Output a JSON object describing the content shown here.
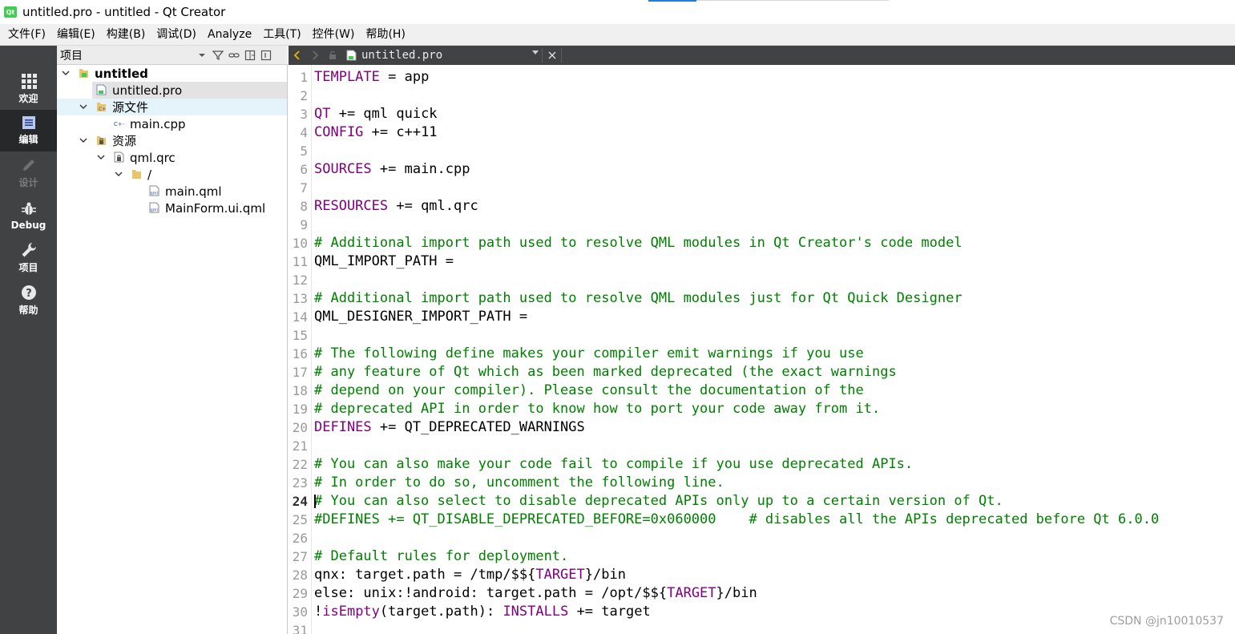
{
  "window": {
    "title": "untitled.pro - untitled - Qt Creator",
    "logo_text": "Qt"
  },
  "menubar": {
    "items": [
      "文件(F)",
      "编辑(E)",
      "构建(B)",
      "调试(D)",
      "Analyze",
      "工具(T)",
      "控件(W)",
      "帮助(H)"
    ]
  },
  "modes": [
    {
      "label": "欢迎",
      "icon": "grid-icon",
      "state": "normal"
    },
    {
      "label": "编辑",
      "icon": "document-icon",
      "state": "active"
    },
    {
      "label": "设计",
      "icon": "pencil-icon",
      "state": "disabled"
    },
    {
      "label": "Debug",
      "icon": "bug-icon",
      "state": "normal"
    },
    {
      "label": "项目",
      "icon": "wrench-icon",
      "state": "normal"
    },
    {
      "label": "帮助",
      "icon": "help-icon",
      "state": "normal"
    }
  ],
  "project_pane": {
    "title": "项目",
    "tools": [
      "filter-icon",
      "link-icon",
      "split-icon",
      "close-pane-icon"
    ],
    "tree": [
      {
        "label": "untitled",
        "bold": true,
        "expanded": true,
        "icon": "project-icon"
      },
      {
        "label": "untitled.pro",
        "selected": true,
        "icon": "pro-file-icon"
      },
      {
        "label": "源文件",
        "expanded": true,
        "icon": "source-folder-icon"
      },
      {
        "label": "main.cpp",
        "icon": "cpp-file-icon"
      },
      {
        "label": "资源",
        "expanded": true,
        "icon": "resource-folder-icon"
      },
      {
        "label": "qml.qrc",
        "expanded": true,
        "icon": "qrc-file-icon"
      },
      {
        "label": "/",
        "expanded": true,
        "icon": "folder-icon"
      },
      {
        "label": "main.qml",
        "icon": "qml-file-icon"
      },
      {
        "label": "MainForm.ui.qml",
        "icon": "qml-file-icon"
      }
    ]
  },
  "editor": {
    "open_file": "untitled.pro",
    "current_line": 24,
    "lines": [
      {
        "n": "1",
        "segs": [
          {
            "t": "TEMPLATE",
            "c": "kw"
          },
          {
            "t": " = app",
            "c": ""
          }
        ]
      },
      {
        "n": "2",
        "segs": []
      },
      {
        "n": "3",
        "segs": [
          {
            "t": "QT",
            "c": "kw"
          },
          {
            "t": " += qml quick",
            "c": ""
          }
        ]
      },
      {
        "n": "4",
        "segs": [
          {
            "t": "CONFIG",
            "c": "kw"
          },
          {
            "t": " += c++11",
            "c": ""
          }
        ]
      },
      {
        "n": "5",
        "segs": []
      },
      {
        "n": "6",
        "segs": [
          {
            "t": "SOURCES",
            "c": "kw"
          },
          {
            "t": " += main.cpp",
            "c": ""
          }
        ]
      },
      {
        "n": "7",
        "segs": []
      },
      {
        "n": "8",
        "segs": [
          {
            "t": "RESOURCES",
            "c": "kw"
          },
          {
            "t": " += qml.qrc",
            "c": ""
          }
        ]
      },
      {
        "n": "9",
        "segs": []
      },
      {
        "n": "10",
        "segs": [
          {
            "t": "# Additional import path used to resolve QML modules in Qt Creator's code model",
            "c": "cm"
          }
        ]
      },
      {
        "n": "11",
        "segs": [
          {
            "t": "QML_IMPORT_PATH =",
            "c": ""
          }
        ]
      },
      {
        "n": "12",
        "segs": []
      },
      {
        "n": "13",
        "segs": [
          {
            "t": "# Additional import path used to resolve QML modules just for Qt Quick Designer",
            "c": "cm"
          }
        ]
      },
      {
        "n": "14",
        "segs": [
          {
            "t": "QML_DESIGNER_IMPORT_PATH =",
            "c": ""
          }
        ]
      },
      {
        "n": "15",
        "segs": []
      },
      {
        "n": "16",
        "segs": [
          {
            "t": "# The following define makes your compiler emit warnings if you use",
            "c": "cm"
          }
        ]
      },
      {
        "n": "17",
        "segs": [
          {
            "t": "# any feature of Qt which as been marked deprecated (the exact warnings",
            "c": "cm"
          }
        ]
      },
      {
        "n": "18",
        "segs": [
          {
            "t": "# depend on your compiler). Please consult the documentation of the",
            "c": "cm"
          }
        ]
      },
      {
        "n": "19",
        "segs": [
          {
            "t": "# deprecated API in order to know how to port your code away from it.",
            "c": "cm"
          }
        ]
      },
      {
        "n": "20",
        "segs": [
          {
            "t": "DEFINES",
            "c": "kw"
          },
          {
            "t": " += QT_DEPRECATED_WARNINGS",
            "c": ""
          }
        ]
      },
      {
        "n": "21",
        "segs": []
      },
      {
        "n": "22",
        "segs": [
          {
            "t": "# You can also make your code fail to compile if you use deprecated APIs.",
            "c": "cm"
          }
        ]
      },
      {
        "n": "23",
        "segs": [
          {
            "t": "# In order to do so, uncomment the following line.",
            "c": "cm"
          }
        ]
      },
      {
        "n": "24",
        "segs": [
          {
            "t": "# You can also select to disable deprecated APIs only up to a certain version of Qt.",
            "c": "cm"
          }
        ]
      },
      {
        "n": "25",
        "segs": [
          {
            "t": "#DEFINES += QT_DISABLE_DEPRECATED_BEFORE=0x060000    # disables all the APIs deprecated before Qt 6.0.0",
            "c": "cm"
          }
        ]
      },
      {
        "n": "26",
        "segs": []
      },
      {
        "n": "27",
        "segs": [
          {
            "t": "# Default rules for deployment.",
            "c": "cm"
          }
        ]
      },
      {
        "n": "28",
        "segs": [
          {
            "t": "qnx: target.path = /tmp/$${",
            "c": ""
          },
          {
            "t": "TARGET",
            "c": "kw"
          },
          {
            "t": "}/bin",
            "c": ""
          }
        ]
      },
      {
        "n": "29",
        "segs": [
          {
            "t": "else: unix:!android: target.path = /opt/$${",
            "c": ""
          },
          {
            "t": "TARGET",
            "c": "kw"
          },
          {
            "t": "}/bin",
            "c": ""
          }
        ]
      },
      {
        "n": "30",
        "segs": [
          {
            "t": "!",
            "c": ""
          },
          {
            "t": "isEmpty",
            "c": "kw"
          },
          {
            "t": "(target.path): ",
            "c": ""
          },
          {
            "t": "INSTALLS",
            "c": "kw"
          },
          {
            "t": " += target",
            "c": ""
          }
        ]
      },
      {
        "n": "31",
        "segs": []
      }
    ]
  },
  "watermark": "CSDN @jn10010537",
  "colors": {
    "keyword": "#800080",
    "comment": "#008000",
    "modebar": "#404244",
    "mode_active": "#262829"
  }
}
